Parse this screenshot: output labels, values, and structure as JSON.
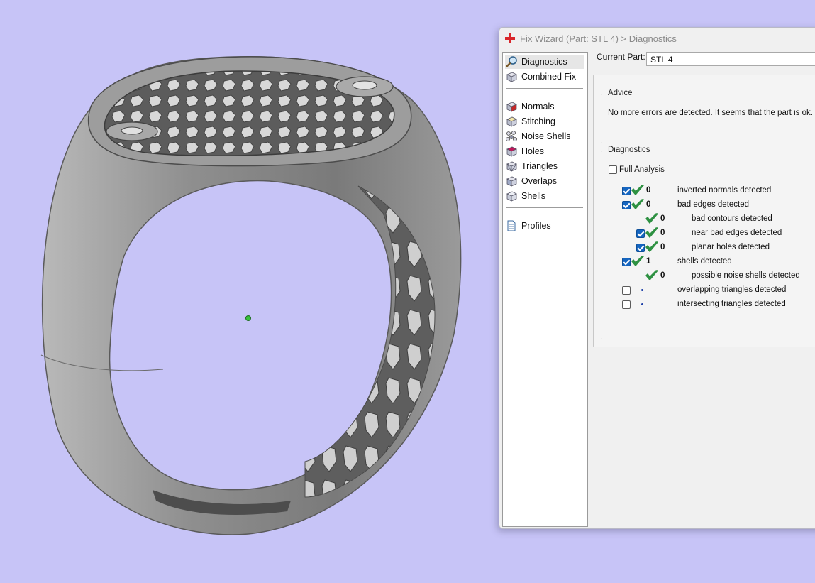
{
  "window": {
    "title": "Fix Wizard (Part: STL 4) > Diagnostics",
    "icon": "red-cross-icon"
  },
  "nav": {
    "items": [
      {
        "label": "Diagnostics",
        "icon": "magnifier-icon",
        "selected": true
      },
      {
        "label": "Combined Fix",
        "icon": "cube-icon",
        "selected": false
      },
      {
        "label": "Normals",
        "icon": "normals-cube-icon",
        "selected": false
      },
      {
        "label": "Stitching",
        "icon": "stitching-cube-icon",
        "selected": false
      },
      {
        "label": "Noise Shells",
        "icon": "noise-shells-icon",
        "selected": false
      },
      {
        "label": "Holes",
        "icon": "holes-cube-icon",
        "selected": false
      },
      {
        "label": "Triangles",
        "icon": "triangles-cube-icon",
        "selected": false
      },
      {
        "label": "Overlaps",
        "icon": "overlaps-cube-icon",
        "selected": false
      },
      {
        "label": "Shells",
        "icon": "shells-cube-icon",
        "selected": false
      },
      {
        "label": "Profiles",
        "icon": "document-icon",
        "selected": false
      }
    ]
  },
  "current_part": {
    "label": "Current Part:",
    "value": "STL 4"
  },
  "advice": {
    "title": "Advice",
    "text": "No more errors are detected. It seems that the part is ok. No"
  },
  "diagnostics": {
    "title": "Diagnostics",
    "full_analysis_label": "Full Analysis",
    "full_analysis_checked": false,
    "rows": [
      {
        "checkbox": true,
        "checked": true,
        "status": "ok",
        "count": "0",
        "label": "inverted normals detected",
        "indent": 0
      },
      {
        "checkbox": true,
        "checked": true,
        "status": "ok",
        "count": "0",
        "label": "bad edges detected",
        "indent": 0
      },
      {
        "checkbox": false,
        "checked": false,
        "status": "ok",
        "count": "0",
        "label": "bad contours detected",
        "indent": 1
      },
      {
        "checkbox": true,
        "checked": true,
        "status": "ok",
        "count": "0",
        "label": "near bad edges detected",
        "indent": 1
      },
      {
        "checkbox": true,
        "checked": true,
        "status": "ok",
        "count": "0",
        "label": "planar holes detected",
        "indent": 1
      },
      {
        "checkbox": true,
        "checked": true,
        "status": "ok",
        "count": "1",
        "label": "shells detected",
        "indent": 0
      },
      {
        "checkbox": false,
        "checked": false,
        "status": "ok",
        "count": "0",
        "label": "possible noise shells detected",
        "indent": 1
      },
      {
        "checkbox": true,
        "checked": false,
        "status": "pending",
        "count": "",
        "label": "overlapping triangles detected",
        "indent": 0
      },
      {
        "checkbox": true,
        "checked": false,
        "status": "pending",
        "count": "",
        "label": "intersecting triangles detected",
        "indent": 0
      }
    ]
  },
  "colors": {
    "viewport_background": "#c7c4f7",
    "ring": "#8c8c8c",
    "check_green": "#2e9142",
    "checkbox_blue": "#1565c0"
  }
}
